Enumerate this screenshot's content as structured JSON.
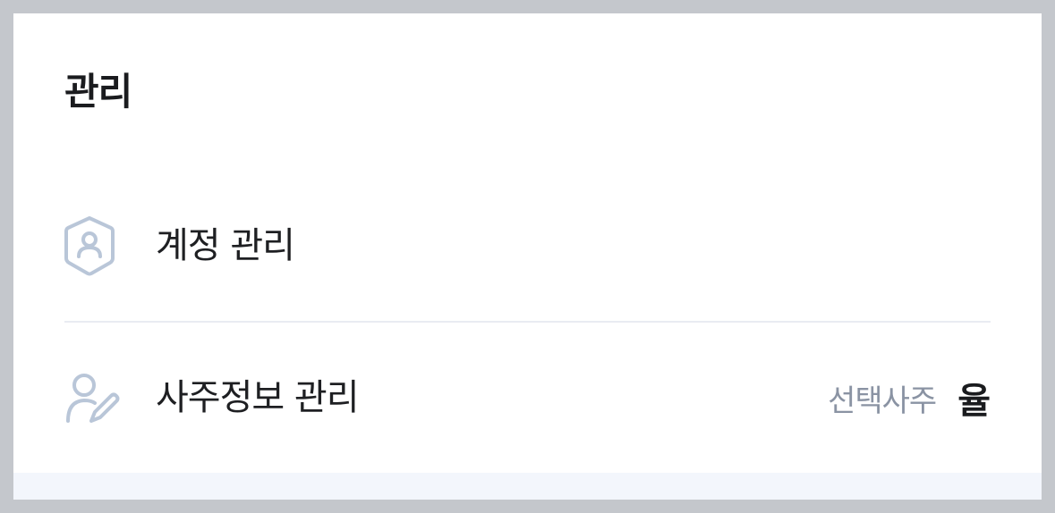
{
  "section": {
    "title": "관리"
  },
  "items": [
    {
      "label": "계정 관리",
      "icon": "shield-user-icon"
    },
    {
      "label": "사주정보 관리",
      "icon": "user-edit-icon",
      "sub_label": "선택사주",
      "value": "율"
    }
  ],
  "colors": {
    "icon": "#b9c6d8",
    "sub_text": "#8a93a3",
    "divider": "#e9ecf2",
    "background_outer": "#c4c7cc"
  }
}
